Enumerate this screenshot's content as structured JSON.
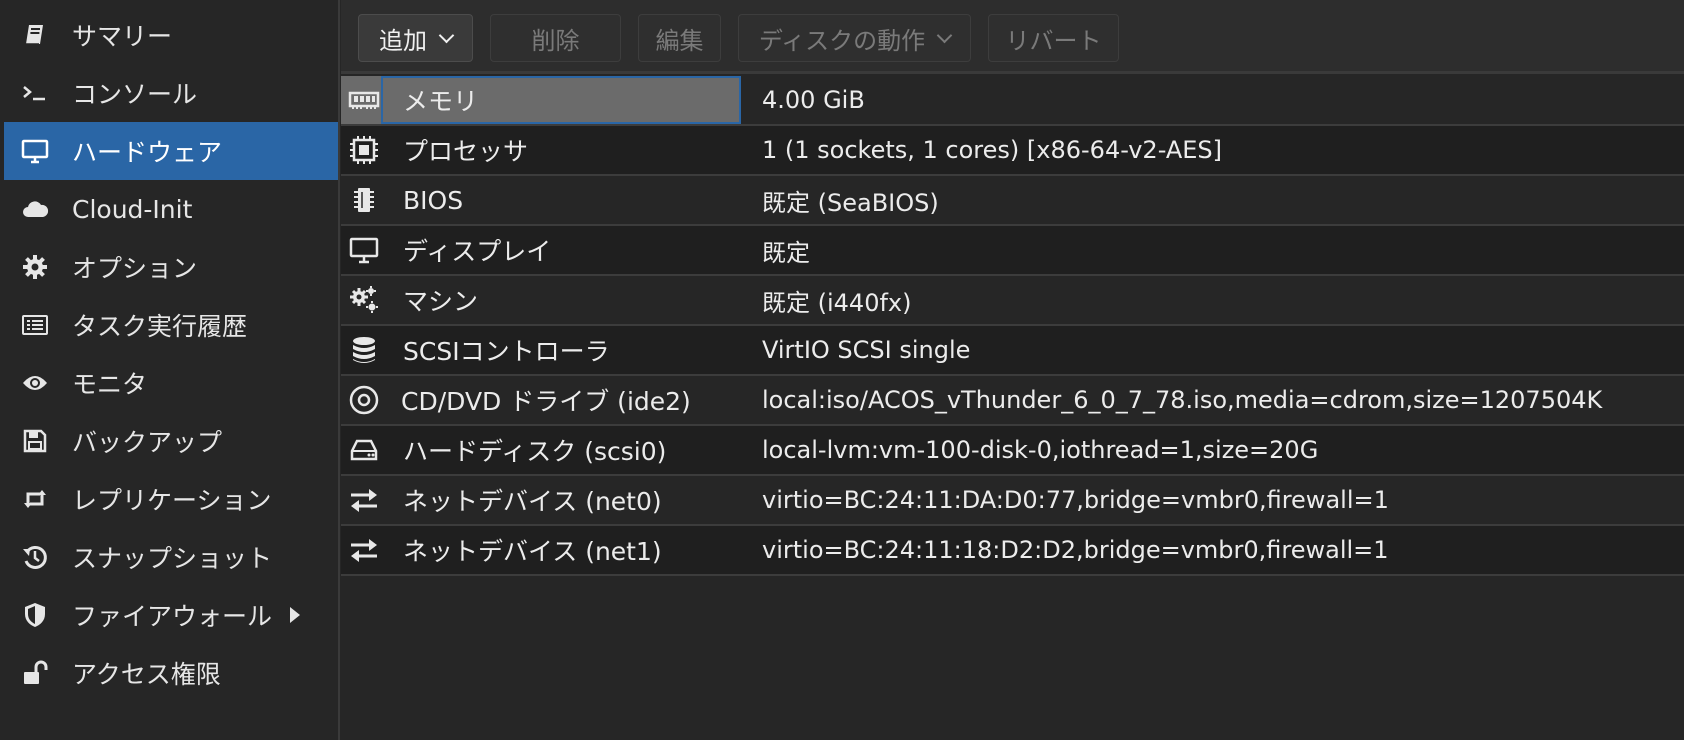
{
  "sidebar": {
    "items": [
      {
        "label": "サマリー",
        "icon": "book-icon"
      },
      {
        "label": "コンソール",
        "icon": "terminal-icon"
      },
      {
        "label": "ハードウェア",
        "icon": "desktop-icon",
        "active": true
      },
      {
        "label": "Cloud-Init",
        "icon": "cloud-icon"
      },
      {
        "label": "オプション",
        "icon": "gear-icon"
      },
      {
        "label": "タスク実行履歴",
        "icon": "list-icon"
      },
      {
        "label": "モニタ",
        "icon": "eye-icon"
      },
      {
        "label": "バックアップ",
        "icon": "floppy-icon"
      },
      {
        "label": "レプリケーション",
        "icon": "retweet-icon"
      },
      {
        "label": "スナップショット",
        "icon": "history-icon"
      },
      {
        "label": "ファイアウォール",
        "icon": "shield-icon",
        "has_submenu": true
      },
      {
        "label": "アクセス権限",
        "icon": "unlock-icon"
      }
    ]
  },
  "toolbar": {
    "add_label": "追加",
    "delete_label": "削除",
    "edit_label": "編集",
    "disk_action_label": "ディスクの動作",
    "revert_label": "リバート"
  },
  "hardware": {
    "rows": [
      {
        "name": "メモリ",
        "value": "4.00 GiB",
        "icon": "memory-icon"
      },
      {
        "name": "プロセッサ",
        "value": "1 (1 sockets, 1 cores) [x86-64-v2-AES]",
        "icon": "cpu-icon"
      },
      {
        "name": "BIOS",
        "value": "既定 (SeaBIOS)",
        "icon": "microchip-icon"
      },
      {
        "name": "ディスプレイ",
        "value": "既定",
        "icon": "desktop-icon"
      },
      {
        "name": "マシン",
        "value": "既定 (i440fx)",
        "icon": "cogs-icon"
      },
      {
        "name": "SCSIコントローラ",
        "value": "VirtIO SCSI single",
        "icon": "database-icon"
      },
      {
        "name": "CD/DVD ドライブ (ide2)",
        "value": "local:iso/ACOS_vThunder_6_0_7_78.iso,media=cdrom,size=1207504K",
        "icon": "cdrom-icon"
      },
      {
        "name": "ハードディスク (scsi0)",
        "value": "local-lvm:vm-100-disk-0,iothread=1,size=20G",
        "icon": "hdd-icon"
      },
      {
        "name": "ネットデバイス (net0)",
        "value": "virtio=BC:24:11:DA:D0:77,bridge=vmbr0,firewall=1",
        "icon": "exchange-icon"
      },
      {
        "name": "ネットデバイス (net1)",
        "value": "virtio=BC:24:11:18:D2:D2,bridge=vmbr0,firewall=1",
        "icon": "exchange-icon"
      }
    ]
  },
  "colors": {
    "accent": "#2a66a6",
    "selected_row": "#6b6b6b",
    "background": "#262626"
  }
}
